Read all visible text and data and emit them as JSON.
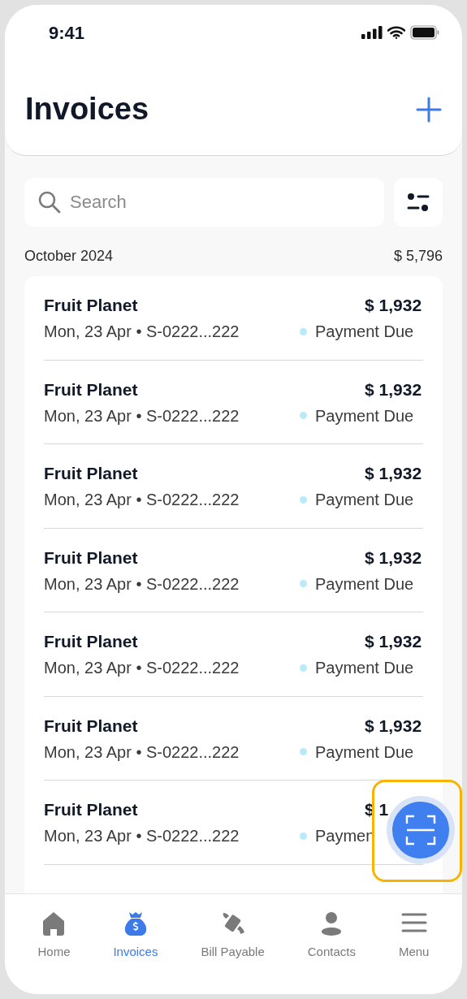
{
  "status_bar": {
    "time": "9:41"
  },
  "header": {
    "title": "Invoices"
  },
  "search": {
    "placeholder": "Search"
  },
  "group": {
    "month": "October 2024",
    "total": "$ 5,796"
  },
  "invoices": [
    {
      "customer": "Fruit Planet",
      "meta": "Mon, 23 Apr • S-0222...222",
      "amount": "$ 1,932",
      "status": "Payment Due",
      "color": "#b9eaf7"
    },
    {
      "customer": "Fruit Planet",
      "meta": "Mon, 23 Apr • S-0222...222",
      "amount": "$ 1,932",
      "status": "Payment Due",
      "color": "#b9eaf7"
    },
    {
      "customer": "Fruit Planet",
      "meta": "Mon, 23 Apr • S-0222...222",
      "amount": "$ 1,932",
      "status": "Payment Due",
      "color": "#b9eaf7"
    },
    {
      "customer": "Fruit Planet",
      "meta": "Mon, 23 Apr • S-0222...222",
      "amount": "$ 1,932",
      "status": "Payment Due",
      "color": "#b9eaf7"
    },
    {
      "customer": "Fruit Planet",
      "meta": "Mon, 23 Apr • S-0222...222",
      "amount": "$ 1,932",
      "status": "Payment Due",
      "color": "#b9eaf7"
    },
    {
      "customer": "Fruit Planet",
      "meta": "Mon, 23 Apr • S-0222...222",
      "amount": "$ 1,932",
      "status": "Payment Due",
      "color": "#b9eaf7"
    },
    {
      "customer": "Fruit Planet",
      "meta": "Mon, 23 Apr • S-0222...222",
      "amount": "$ 1",
      "status": "Paymen",
      "color": "#b9eaf7"
    }
  ],
  "nav": [
    {
      "kind": "home",
      "label": "Home",
      "selected": false
    },
    {
      "kind": "moneybag",
      "label": "Invoices",
      "selected": true
    },
    {
      "kind": "bill",
      "label": "Bill Payable",
      "selected": false
    },
    {
      "kind": "person",
      "label": "Contacts",
      "selected": false
    },
    {
      "kind": "menu",
      "label": "Menu",
      "selected": false
    }
  ]
}
